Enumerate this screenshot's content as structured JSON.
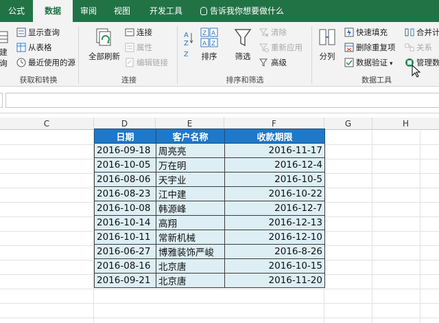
{
  "tabs": [
    {
      "label": "公式",
      "active": false
    },
    {
      "label": "数据",
      "active": true
    },
    {
      "label": "审阅",
      "active": false
    },
    {
      "label": "视图",
      "active": false
    },
    {
      "label": "开发工具",
      "active": false
    }
  ],
  "tell_me": "告诉我你想要做什么",
  "ribbon": {
    "get_transform": {
      "partial_label_top": "建",
      "partial_label_bottom": "询",
      "show_query": "显示查询",
      "from_table": "从表格",
      "recent_sources": "最近使用的源",
      "group_label": "获取和转换"
    },
    "connections": {
      "refresh_all": "全部刷新",
      "connections": "连接",
      "properties": "属性",
      "edit_links": "编辑链接",
      "group_label": "连接"
    },
    "sort_filter": {
      "sort": "排序",
      "filter": "筛选",
      "clear": "清除",
      "reapply": "重新应用",
      "advanced": "高级",
      "group_label": "排序和筛选"
    },
    "data_tools": {
      "text_to_columns": "分列",
      "flash_fill": "快速填充",
      "remove_duplicates": "删除重复项",
      "data_validation": "数据验证",
      "consolidate": "合并计",
      "relationships": "关系",
      "manage_model": "管理数",
      "group_label": "数据工具"
    }
  },
  "columns": [
    "C",
    "D",
    "E",
    "F",
    "G",
    "H"
  ],
  "table": {
    "headers": [
      "日期",
      "客户名称",
      "收款期限"
    ],
    "rows": [
      [
        "2016-09-18",
        "周亮亮",
        "2016-11-17"
      ],
      [
        "2016-10-05",
        "万在明",
        "2016-12-4"
      ],
      [
        "2016-08-06",
        "天宇业",
        "2016-10-5"
      ],
      [
        "2016-08-23",
        "江中建",
        "2016-10-22"
      ],
      [
        "2016-10-08",
        "韩源峰",
        "2016-12-7"
      ],
      [
        "2016-10-14",
        "高翔",
        "2016-12-13"
      ],
      [
        "2016-10-11",
        "常新机械",
        "2016-12-10"
      ],
      [
        "2016-06-27",
        "博雅装饰严峻",
        "2016-8-26"
      ],
      [
        "2016-08-16",
        "北京唐",
        "2016-10-15"
      ],
      [
        "2016-09-21",
        "北京唐",
        "2016-11-20"
      ]
    ]
  },
  "colors": {
    "ribbon_green": "#217346",
    "header_blue": "#1f78c8",
    "cell_fill": "#ddeef5"
  }
}
